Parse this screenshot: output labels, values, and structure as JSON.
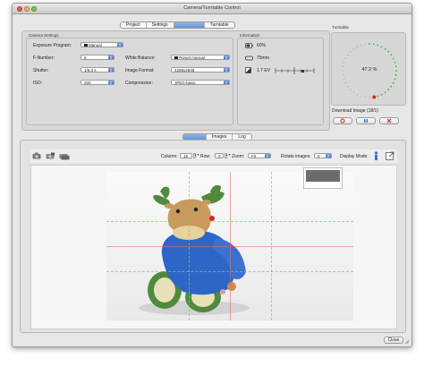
{
  "window": {
    "title": "Camera/Turntable Control"
  },
  "tabs": [
    {
      "label": "Project",
      "active": false
    },
    {
      "label": "Settings",
      "active": false
    },
    {
      "label": "",
      "active": true
    },
    {
      "label": "Turntable",
      "active": false
    }
  ],
  "camera_settings": {
    "title": "Camera Settings",
    "fields": {
      "exposure_program": {
        "label": "Exposure Program:",
        "value": "Manual"
      },
      "f_number": {
        "label": "F-Number:",
        "value": "8"
      },
      "shutter": {
        "label": "Shutter:",
        "value": "1/6.0 s"
      },
      "iso": {
        "label": "ISO:",
        "value": "200"
      },
      "white_balance": {
        "label": "White Balance:",
        "value": "Preset manual"
      },
      "image_format": {
        "label": "Image Format:",
        "value": "4288x2848"
      },
      "compression": {
        "label": "Compression:",
        "value": "JPEG-basic"
      }
    }
  },
  "information": {
    "title": "Information",
    "battery": "60%",
    "focal_length": "75mm",
    "exposure_comp": "1.7 EV"
  },
  "turntable": {
    "title": "Turntable",
    "progress_text": "47.2 %",
    "progress": 0.472,
    "download_text": "Download Image (18/1)",
    "dot_color_done": "#3cb043",
    "dot_color_pending": "#bbbbbb",
    "marker_color": "#d9261c"
  },
  "bottom_tabs": [
    {
      "label": "",
      "active": true
    },
    {
      "label": "Images",
      "active": false
    },
    {
      "label": "Log",
      "active": false
    }
  ],
  "toolbar": {
    "column_label": "Column:",
    "column_value": "16",
    "row_label": "Row:",
    "row_value": "0",
    "zoom_label": "Zoom:",
    "zoom_value": "Fit",
    "rotate_label": "Rotate images:",
    "rotate_value": "0",
    "display_mode_label": "Display Mode:"
  },
  "footer": {
    "close_label": "Close"
  },
  "colors": {
    "accent": "#5f93d6",
    "red": "#d9261c",
    "green": "#3cb043"
  }
}
